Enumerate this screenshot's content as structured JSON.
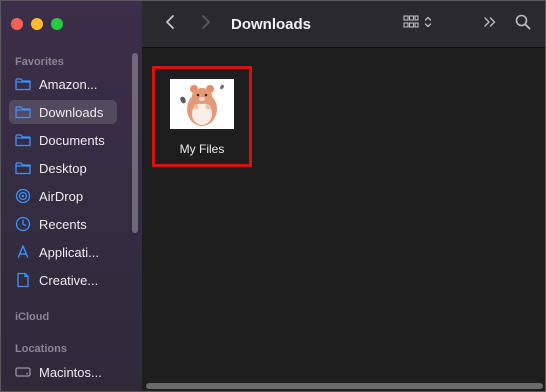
{
  "window": {
    "title": "Downloads"
  },
  "sidebar": {
    "sections": {
      "favorites": "Favorites",
      "icloud": "iCloud",
      "locations": "Locations"
    },
    "items": [
      {
        "label": "Amazon...",
        "icon": "folder-icon"
      },
      {
        "label": "Downloads",
        "icon": "folder-icon",
        "selected": true
      },
      {
        "label": "Documents",
        "icon": "folder-icon"
      },
      {
        "label": "Desktop",
        "icon": "folder-icon"
      },
      {
        "label": "AirDrop",
        "icon": "airdrop-icon"
      },
      {
        "label": "Recents",
        "icon": "clock-icon"
      },
      {
        "label": "Applicati...",
        "icon": "applications-icon"
      },
      {
        "label": "Creative...",
        "icon": "document-icon"
      }
    ],
    "location_items": [
      {
        "label": "Macintos...",
        "icon": "disk-icon"
      }
    ]
  },
  "toolbar": {
    "back_icon": "chevron-left-icon",
    "forward_icon": "chevron-right-icon",
    "view_icon": "grid-view-icon",
    "more_icon": "double-chevron-icon",
    "search_icon": "search-icon"
  },
  "files": [
    {
      "name": "My Files",
      "thumbnail": "hamster-image"
    }
  ],
  "colors": {
    "accent": "#3d92ff",
    "selection_border": "#d9100f",
    "sidebar_bg": "#3a2e47"
  }
}
